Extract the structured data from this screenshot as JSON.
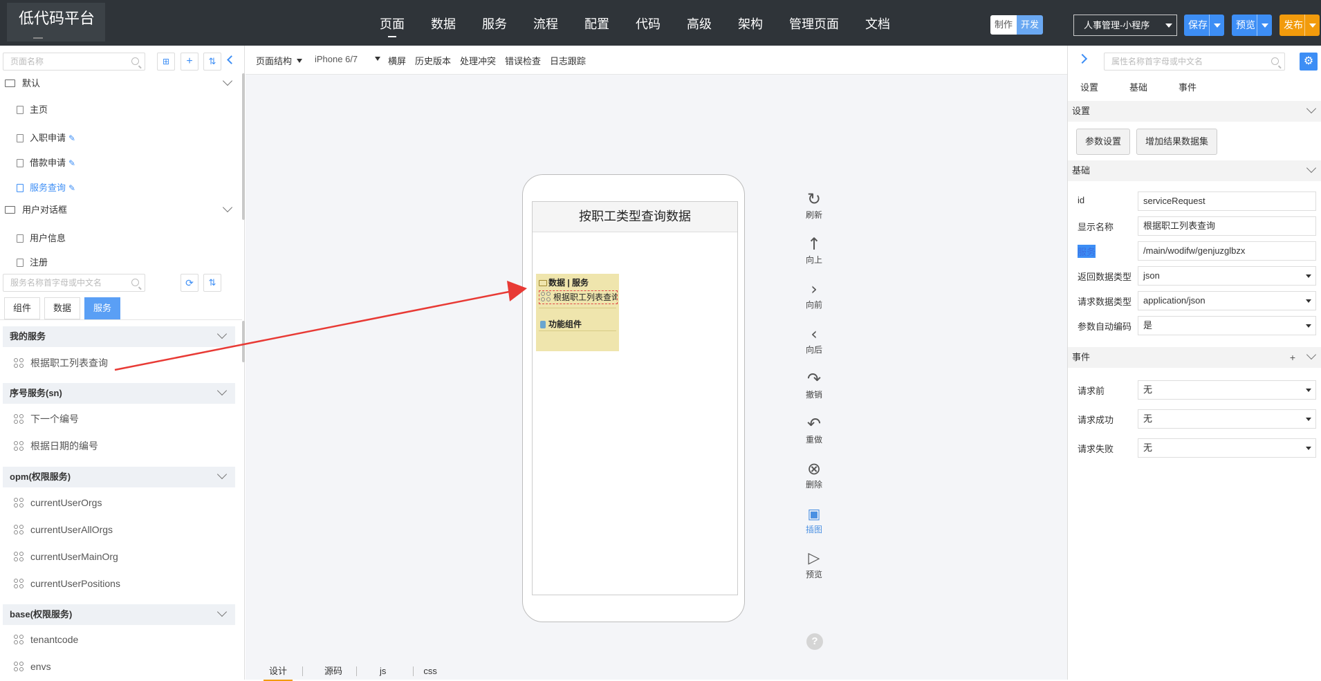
{
  "brand": "低代码平台",
  "nav": [
    "页面",
    "数据",
    "服务",
    "流程",
    "配置",
    "代码",
    "高级",
    "架构",
    "管理页面",
    "文档"
  ],
  "mode": {
    "make": "制作",
    "dev": "开发"
  },
  "project_select": "人事管理-小程序",
  "actions": {
    "save": "保存",
    "preview": "预览",
    "publish": "发布"
  },
  "left": {
    "page_search_placeholder": "页面名称",
    "add_icon": "+",
    "groups": [
      {
        "label": "默认",
        "items": [
          {
            "label": "主页"
          },
          {
            "label": "入职申请"
          },
          {
            "label": "借款申请"
          },
          {
            "label": "服务查询"
          }
        ]
      },
      {
        "label": "用户对话框",
        "items": [
          {
            "label": "用户信息"
          },
          {
            "label": "注册"
          }
        ]
      }
    ],
    "service_search_placeholder": "服务名称首字母或中文名",
    "tabs": [
      "组件",
      "数据",
      "服务"
    ],
    "service_groups": [
      {
        "label": "我的服务",
        "items": [
          "根据职工列表查询"
        ]
      },
      {
        "label": "序号服务(sn)",
        "items": [
          "下一个编号",
          "根据日期的编号"
        ]
      },
      {
        "label": "opm(权限服务)",
        "items": [
          "currentUserOrgs",
          "currentUserAllOrgs",
          "currentUserMainOrg",
          "currentUserPositions"
        ]
      },
      {
        "label": "base(权限服务)",
        "items": [
          "tenantcode",
          "envs"
        ]
      }
    ]
  },
  "center": {
    "toolbar": {
      "structure": "页面结构",
      "device": "iPhone 6/7",
      "landscape": "横屏",
      "history": "历史版本",
      "conflict": "处理冲突",
      "check": "错误检查",
      "log": "日志跟踪"
    },
    "page_title": "按职工类型查询数据",
    "data_box": {
      "header": "数据 | 服务",
      "selected": "根据职工列表查询",
      "func": "功能组件"
    },
    "tools": [
      {
        "label": "刷新",
        "icon": "refresh-icon"
      },
      {
        "label": "向上",
        "icon": "up-icon"
      },
      {
        "label": "向前",
        "icon": "forward-icon"
      },
      {
        "label": "向后",
        "icon": "back-icon"
      },
      {
        "label": "撤销",
        "icon": "undo-icon"
      },
      {
        "label": "重做",
        "icon": "redo-icon"
      },
      {
        "label": "删除",
        "icon": "delete-icon"
      },
      {
        "label": "插图",
        "icon": "image-icon"
      },
      {
        "label": "预览",
        "icon": "play-icon"
      }
    ],
    "help": "?",
    "bottom_tabs": [
      "设计",
      "源码",
      "js",
      "css"
    ],
    "accent": "#f29b0c",
    "arrow_color": "#e83a35"
  },
  "right": {
    "search_placeholder": "属性名称首字母或中文名",
    "tabs": [
      "设置",
      "基础",
      "事件"
    ],
    "sections": {
      "settings": "设置",
      "basic": "基础",
      "events": "事件",
      "events_add": "+"
    },
    "buttons": [
      "参数设置",
      "增加结果数据集"
    ],
    "props": [
      {
        "label": "id",
        "value": "serviceRequest"
      },
      {
        "label": "显示名称",
        "value": "根据职工列表查询"
      },
      {
        "label": "服务",
        "value": "/main/wodifw/genjuzglbzx"
      },
      {
        "label": "返回数据类型",
        "value": "json"
      },
      {
        "label": "请求数据类型",
        "value": "application/json"
      },
      {
        "label": "参数自动编码",
        "value": "是"
      }
    ],
    "events": [
      {
        "label": "请求前",
        "value": "无"
      },
      {
        "label": "请求成功",
        "value": "无"
      },
      {
        "label": "请求失败",
        "value": "无"
      }
    ]
  }
}
